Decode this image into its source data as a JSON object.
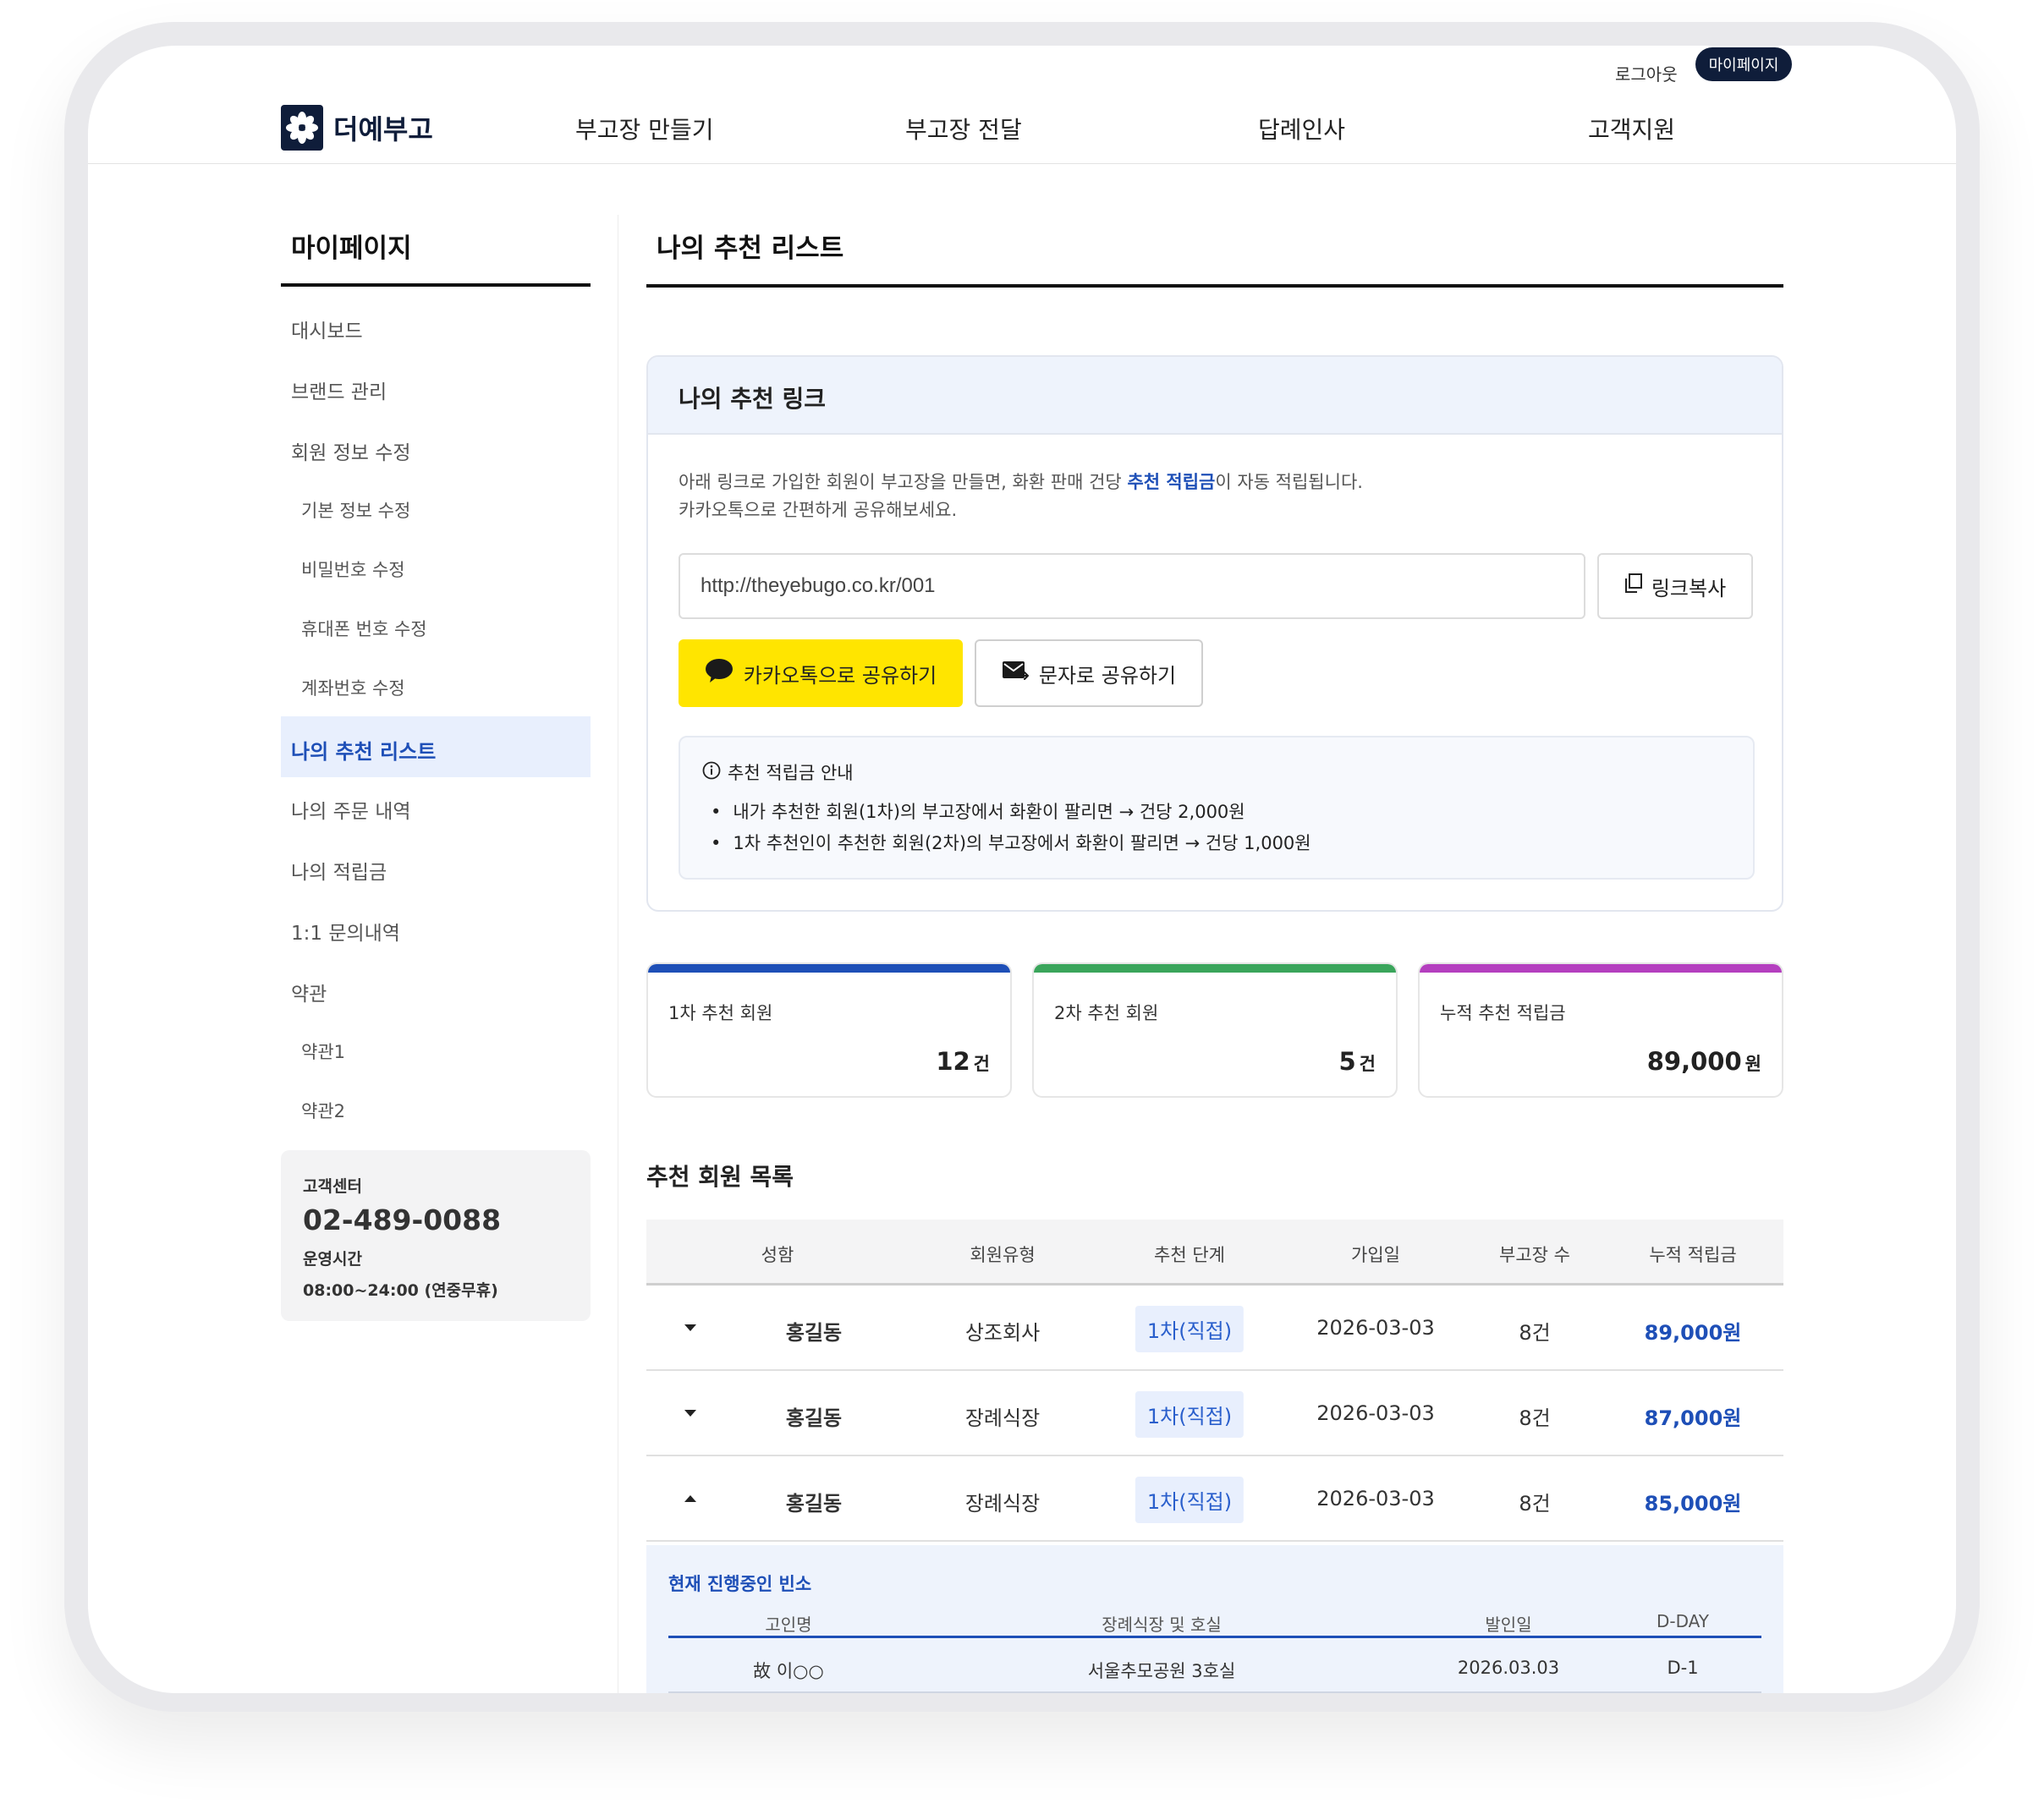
{
  "header": {
    "logout": "로그아웃",
    "mypage": "마이페이지",
    "logo_text": "더예부고",
    "nav": [
      "부고장 만들기",
      "부고장 전달",
      "답례인사",
      "고객지원"
    ]
  },
  "sidebar": {
    "title": "마이페이지",
    "items": {
      "dashboard": "대시보드",
      "brand": "브랜드 관리",
      "member_edit": "회원 정보 수정",
      "basic_edit": "기본 정보 수정",
      "password_edit": "비밀번호 수정",
      "phone_edit": "휴대폰 번호 수정",
      "account_edit": "계좌번호 수정",
      "referral_list": "나의 추천 리스트",
      "orders": "나의 주문 내역",
      "points": "나의 적립금",
      "inquiry": "1:1 문의내역",
      "terms": "약관",
      "terms1": "약관1",
      "terms2": "약관2"
    },
    "cs": {
      "label": "고객센터",
      "phone": "02-489-0088",
      "hours_label": "운영시간",
      "hours": "08:00~24:00 (연중무휴)"
    }
  },
  "main": {
    "title": "나의 추천 리스트",
    "referral_link": {
      "heading": "나의 추천 링크",
      "desc_pre": "아래 링크로 가입한 회원이 부고장을 만들면, 화환 판매 건당 ",
      "desc_highlight": "추천 적립금",
      "desc_post": "이 자동 적립됩니다.",
      "desc_line2": "카카오톡으로 간편하게 공유해보세요.",
      "url": "http://theyebugo.co.kr/001",
      "copy_label": "링크복사",
      "kakao_label": "카카오톡으로 공유하기",
      "sms_label": "문자로 공유하기",
      "notice_title": "추천 적립금 안내",
      "notice_items": [
        "내가 추천한 회원(1차)의 부고장에서 화환이 팔리면 → 건당 2,000원",
        "1차 추천인이 추천한 회원(2차)의 부고장에서 화환이 팔리면 → 건당 1,000원"
      ]
    },
    "stats": [
      {
        "label": "1차 추천 회원",
        "value": "12",
        "unit": "건",
        "color": "#1e4fb7"
      },
      {
        "label": "2차 추천 회원",
        "value": "5",
        "unit": "건",
        "color": "#3aa55b"
      },
      {
        "label": "누적 추천 적립금",
        "value": "89,000",
        "unit": "원",
        "color": "#b43fbf"
      }
    ],
    "list_title": "추천 회원 목록",
    "table": {
      "headers": [
        "성함",
        "회원유형",
        "추천 단계",
        "가입일",
        "부고장 수",
        "누적 적립금"
      ],
      "rows": [
        {
          "name": "홍길동",
          "type": "상조회사",
          "level": "1차(직접)",
          "date": "2026-03-03",
          "count": "8건",
          "amount": "89,000원"
        },
        {
          "name": "홍길동",
          "type": "장례식장",
          "level": "1차(직접)",
          "date": "2026-03-03",
          "count": "8건",
          "amount": "87,000원"
        },
        {
          "name": "홍길동",
          "type": "장례식장",
          "level": "1차(직접)",
          "date": "2026-03-03",
          "count": "8건",
          "amount": "85,000원"
        }
      ]
    },
    "sub": {
      "title": "현재 진행중인 빈소",
      "headers": [
        "고인명",
        "장례식장 및 호실",
        "발인일",
        "D-DAY"
      ],
      "rows": [
        {
          "name": "故 이○○",
          "place": "서울추모공원 3호실",
          "date": "2026.03.03",
          "dday": "D-1"
        }
      ]
    }
  }
}
